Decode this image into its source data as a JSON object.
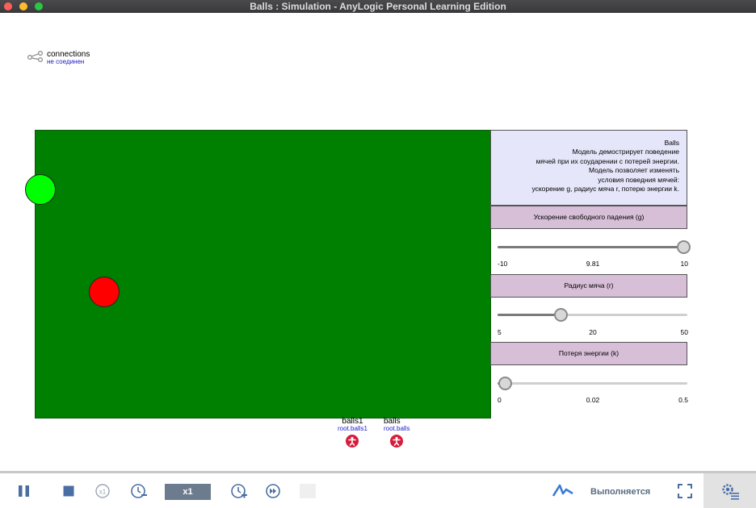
{
  "window": {
    "title": "Balls : Simulation - AnyLogic Personal Learning Edition"
  },
  "connections": {
    "name": "connections",
    "status": "не соединен",
    "icon": "network-share-icon"
  },
  "info": {
    "lines": [
      "Balls",
      "Модель демострирует поведение",
      "мячей при их соударении с потерей энергии.",
      "Модель позволяет изменять",
      "условия поведния мячей:",
      "ускорение g, радиус мяча r, потерю энергии k."
    ]
  },
  "params": {
    "gravity": {
      "label": "Ускорение свободного падения (g)",
      "min": "-10",
      "value": "9.81",
      "max": "10",
      "fraction": 0.98
    },
    "radius": {
      "label": "Радиус мяча (r)",
      "min": "5",
      "value": "20",
      "max": "50",
      "fraction": 0.333
    },
    "loss": {
      "label": "Потеря энергии (k)",
      "min": "0",
      "value": "0.02",
      "max": "0.5",
      "fraction": 0.04
    }
  },
  "balls": [
    {
      "color": "#00ff00",
      "name": "green-ball"
    },
    {
      "color": "#ff0000",
      "name": "red-ball"
    }
  ],
  "agents": [
    {
      "name": "balls1",
      "path": "root.balls1"
    },
    {
      "name": "balls",
      "path": "root.balls"
    }
  ],
  "toolbar": {
    "speed": "x1",
    "status": "Выполняется"
  },
  "colors": {
    "field": "#008000",
    "info_bg": "#e6e6fa",
    "param_bg": "#d8bfd8",
    "accent": "#4a6ea3"
  }
}
